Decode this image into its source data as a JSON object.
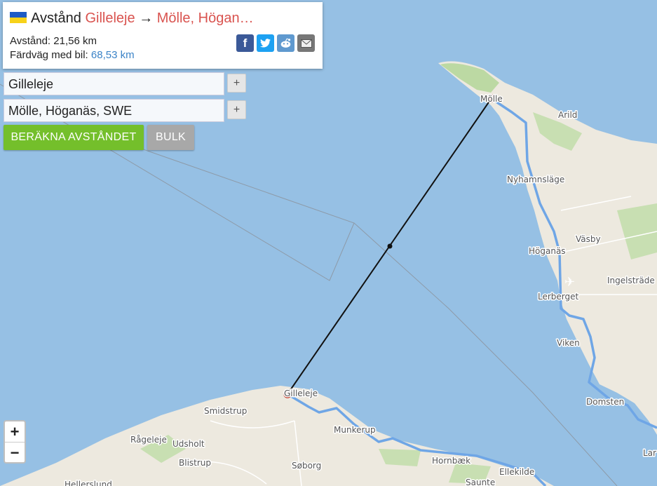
{
  "header": {
    "title_prefix": "Avstånd",
    "from": "Gilleleje",
    "arrow": "→",
    "to": "Mölle, Högan…",
    "distance": "Avstånd: 21,56 km",
    "drive_label": "Färdväg med bil:",
    "drive_value": "68,53 km"
  },
  "inputs": {
    "from_value": "Gilleleje",
    "to_value": "Mölle, Höganäs, SWE",
    "plus": "+"
  },
  "buttons": {
    "calculate": "BERÄKNA AVSTÅNDET",
    "bulk": "BULK"
  },
  "zoom": {
    "in": "+",
    "out": "−"
  },
  "colors": {
    "calculate": "#74bf2b",
    "bulk": "#a8a8a8",
    "route": "#6fa6e6",
    "water": "#96c0e4",
    "land": "#ede9df"
  },
  "share": [
    {
      "icon": "facebook-icon",
      "glyph": "f",
      "color": "#3b5998"
    },
    {
      "icon": "twitter-icon",
      "glyph": "🐦",
      "color": "#1da1f2"
    },
    {
      "icon": "reddit-icon",
      "glyph": "●",
      "color": "#5f99cf"
    },
    {
      "icon": "email-icon",
      "glyph": "✉",
      "color": "#777777"
    }
  ],
  "map_labels": {
    "molle": "Mölle",
    "arild": "Arild",
    "nyhamnslage": "Nyhamnsläge",
    "vasby": "Väsby",
    "hoganas": "Höganäs",
    "ingelstrade": "Ingelsträde",
    "lerberget": "Lerberget",
    "viken": "Viken",
    "domsten": "Domsten",
    "lar": "Lar",
    "gilleleje": "Gilleleje",
    "smidstrup": "Smidstrup",
    "munkerup": "Munkerup",
    "rageleje": "Rågeleje",
    "udsholt": "Udsholt",
    "blistrup": "Blistrup",
    "soborg": "Søborg",
    "hornbaek": "Hornbæk",
    "ellekilde": "Ellekilde",
    "saunte": "Saunte",
    "hellerslund": "Hellerslund"
  }
}
